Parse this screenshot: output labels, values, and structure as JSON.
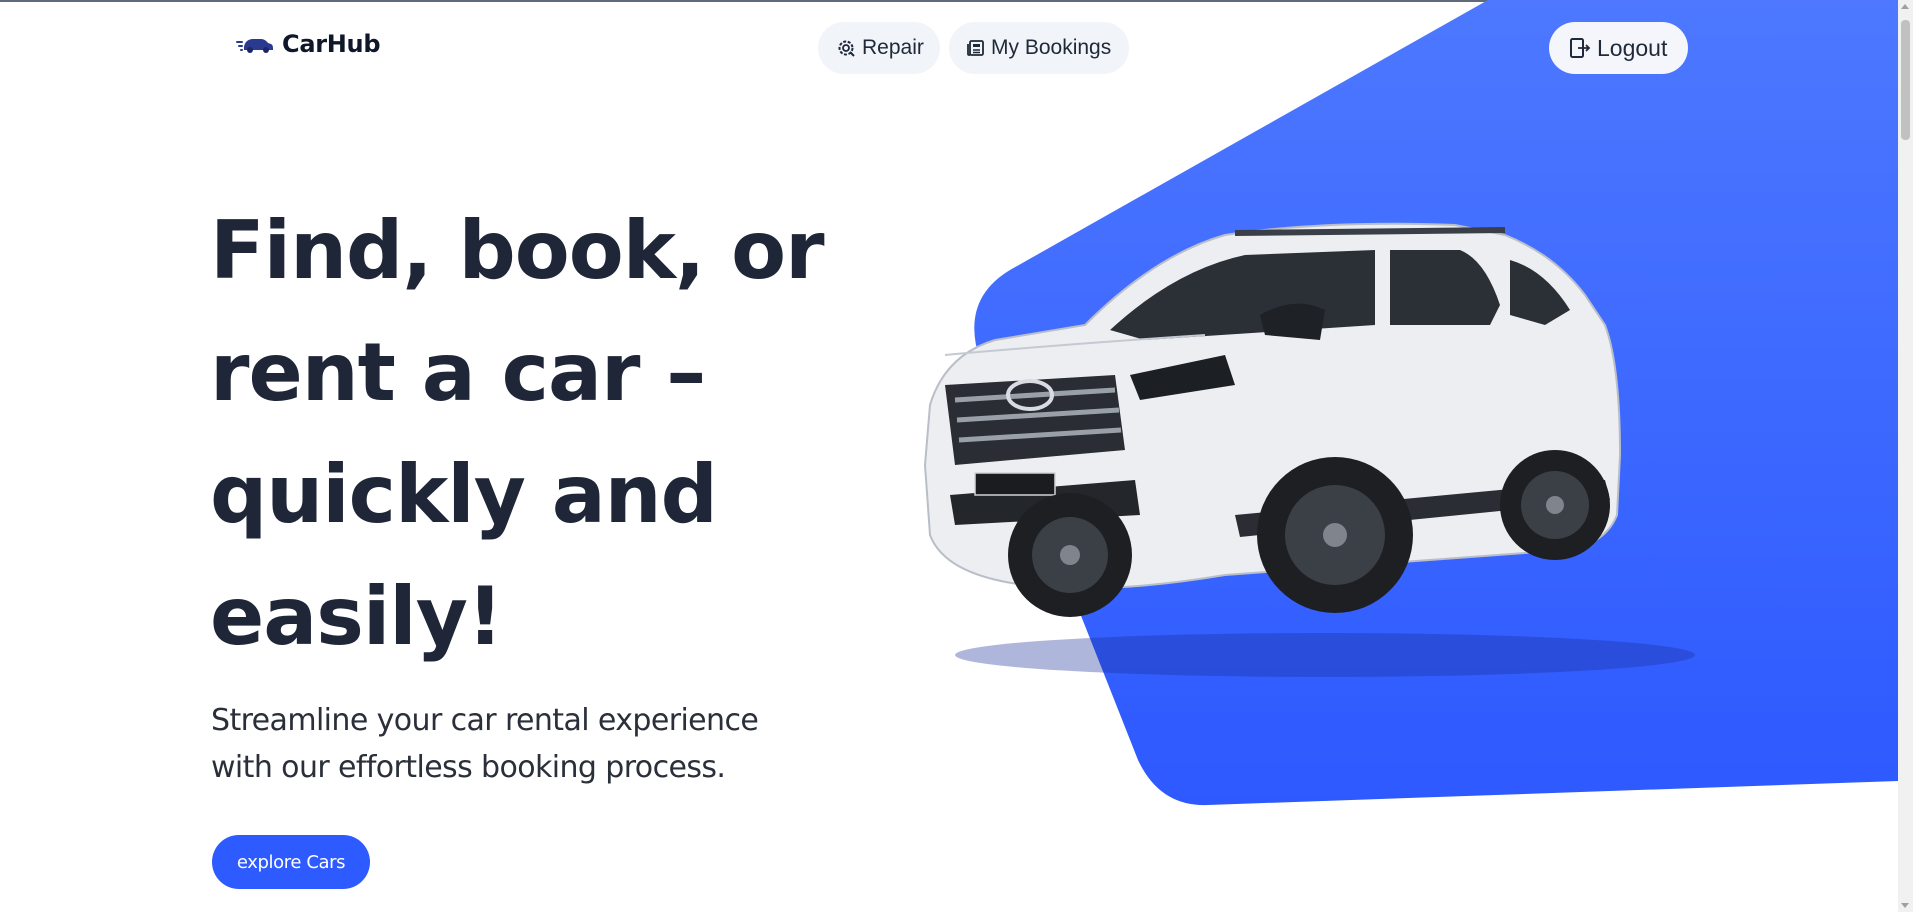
{
  "brand": {
    "name": "CarHub",
    "logo_icon": "speeding-car-icon"
  },
  "nav": {
    "repair_label": "Repair",
    "repair_icon": "gear-badge-icon",
    "bookings_label": "My Bookings",
    "bookings_icon": "newspaper-icon",
    "logout_label": "Logout",
    "logout_icon": "door-exit-icon"
  },
  "hero": {
    "headline": "Find, book, or rent a car – quickly and easily!",
    "subtitle": "Streamline your car rental experience with our effortless booking process.",
    "cta_label": "explore Cars",
    "image_icon": "white-suv-image"
  },
  "colors": {
    "accent": "#2e5bff",
    "accent_light": "#4a75ff",
    "text_dark": "#1e2638",
    "pill_bg": "#f1f4f9"
  }
}
